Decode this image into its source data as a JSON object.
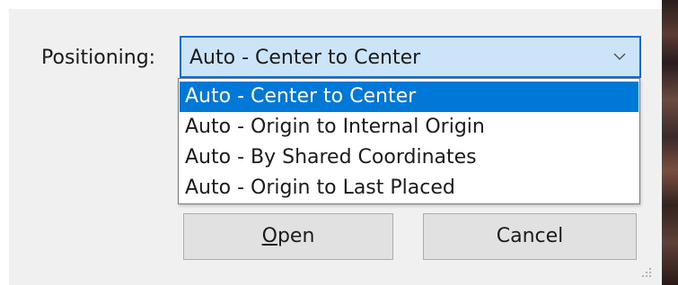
{
  "positioning": {
    "label": "Positioning:",
    "selected_value": "Auto - Center to Center",
    "options": [
      "Auto - Center to Center",
      "Auto - Origin to Internal Origin",
      "Auto - By Shared Coordinates",
      "Auto - Origin to Last Placed"
    ],
    "highlighted_index": 0
  },
  "buttons": {
    "open_accel": "O",
    "open_rest": "pen",
    "cancel_label": "Cancel"
  },
  "icons": {
    "dropdown": "chevron-down-icon",
    "resize": "resize-grip-icon"
  },
  "colors": {
    "accent": "#0078d7",
    "combo_focus_bg": "#cce4f7",
    "dialog_bg": "#f0f0f0"
  }
}
